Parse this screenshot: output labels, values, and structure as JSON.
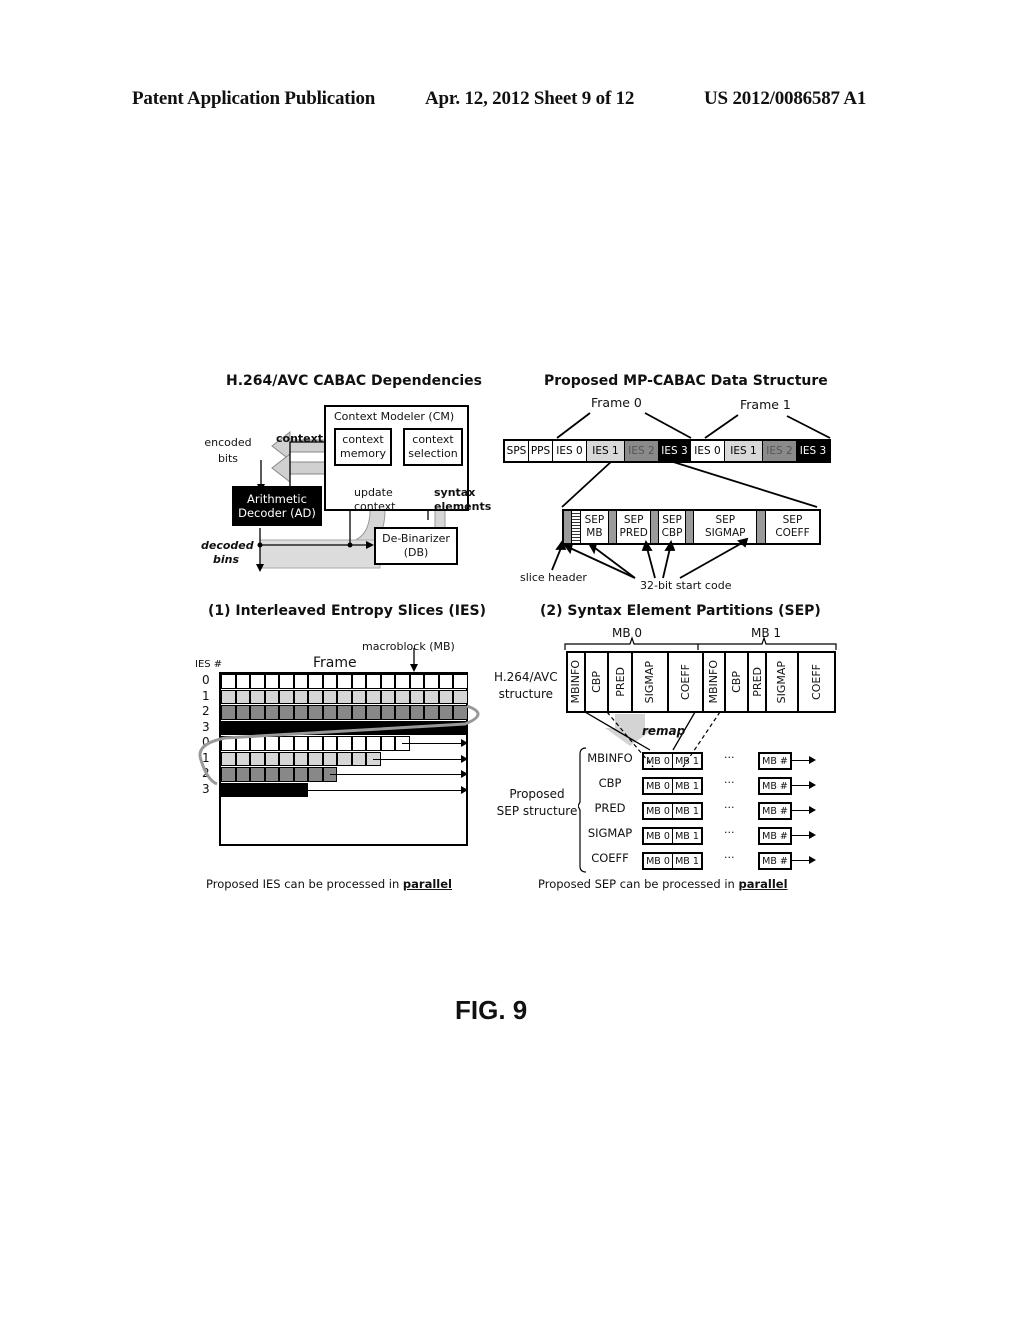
{
  "header": {
    "publication": "Patent Application Publication",
    "date_sheet": "Apr. 12, 2012  Sheet 9 of 12",
    "number": "US 2012/0086587 A1"
  },
  "panel_cabac": {
    "title": "H.264/AVC CABAC Dependencies",
    "context_modeler": "Context Modeler (CM)",
    "context_memory": [
      "context",
      "memory"
    ],
    "context_selection": [
      "context",
      "selection"
    ],
    "arithmetic_decoder": [
      "Arithmetic",
      "Decoder (AD)"
    ],
    "debinarizer": [
      "De-Binarizer",
      "(DB)"
    ],
    "encoded_bits": [
      "encoded",
      "bits"
    ],
    "context_label": "context",
    "update_context": [
      "update",
      "context"
    ],
    "syntax_elements": [
      "syntax",
      "elements"
    ],
    "decoded_bins": [
      "decoded",
      "bins"
    ]
  },
  "panel_mpcabac": {
    "title": "Proposed MP-CABAC  Data Structure",
    "frame0": "Frame 0",
    "frame1": "Frame 1",
    "stream": [
      {
        "label": "SPS",
        "shade": "white"
      },
      {
        "label": "PPS",
        "shade": "white"
      },
      {
        "label": "IES 0",
        "shade": "white"
      },
      {
        "label": "IES 1",
        "shade": "light"
      },
      {
        "label": "IES 2",
        "shade": "mid"
      },
      {
        "label": "IES 3",
        "shade": "dark"
      },
      {
        "label": "IES 0",
        "shade": "white"
      },
      {
        "label": "IES 1",
        "shade": "light"
      },
      {
        "label": "IES 2",
        "shade": "mid"
      },
      {
        "label": "IES 3",
        "shade": "dark"
      }
    ],
    "partitions": [
      [
        "SEP",
        "MB"
      ],
      [
        "SEP",
        "PRED"
      ],
      [
        "SEP",
        "CBP"
      ],
      [
        "SEP",
        "SIGMAP"
      ],
      [
        "SEP",
        "COEFF"
      ]
    ],
    "slice_header": "slice header",
    "start_code": "32-bit start code"
  },
  "panel_ies": {
    "title": "(1) Interleaved Entropy Slices (IES)",
    "ies_hash": "IES #",
    "frame": "Frame",
    "macroblock": "macroblock (MB)",
    "row_labels": [
      "0",
      "1",
      "2",
      "3",
      "0",
      "1",
      "2",
      "3"
    ],
    "columns": 17,
    "second_pass_filled": [
      13,
      11,
      8,
      6
    ],
    "caption_prefix": "Proposed IES can be processed in ",
    "caption_emph": "parallel"
  },
  "panel_sep": {
    "title": "(2) Syntax Element Partitions (SEP)",
    "mb0": "MB 0",
    "mb1": "MB 1",
    "h264_structure": [
      "H.264/AVC",
      "structure"
    ],
    "h264_columns": [
      "MBINFO",
      "CBP",
      "PRED",
      "SIGMAP",
      "COEFF",
      "MBINFO",
      "CBP",
      "PRED",
      "SIGMAP",
      "COEFF"
    ],
    "remap": "remap",
    "proposed": [
      "Proposed",
      "SEP structure"
    ],
    "rows": [
      "MBINFO",
      "CBP",
      "PRED",
      "SIGMAP",
      "COEFF"
    ],
    "cell_mb0": "MB 0",
    "cell_mb1": "MB 1",
    "cell_mbn": "MB #",
    "ellipsis": "···",
    "caption_prefix": "Proposed SEP can be processed in ",
    "caption_emph": "parallel"
  },
  "figure_label": "FIG. 9"
}
